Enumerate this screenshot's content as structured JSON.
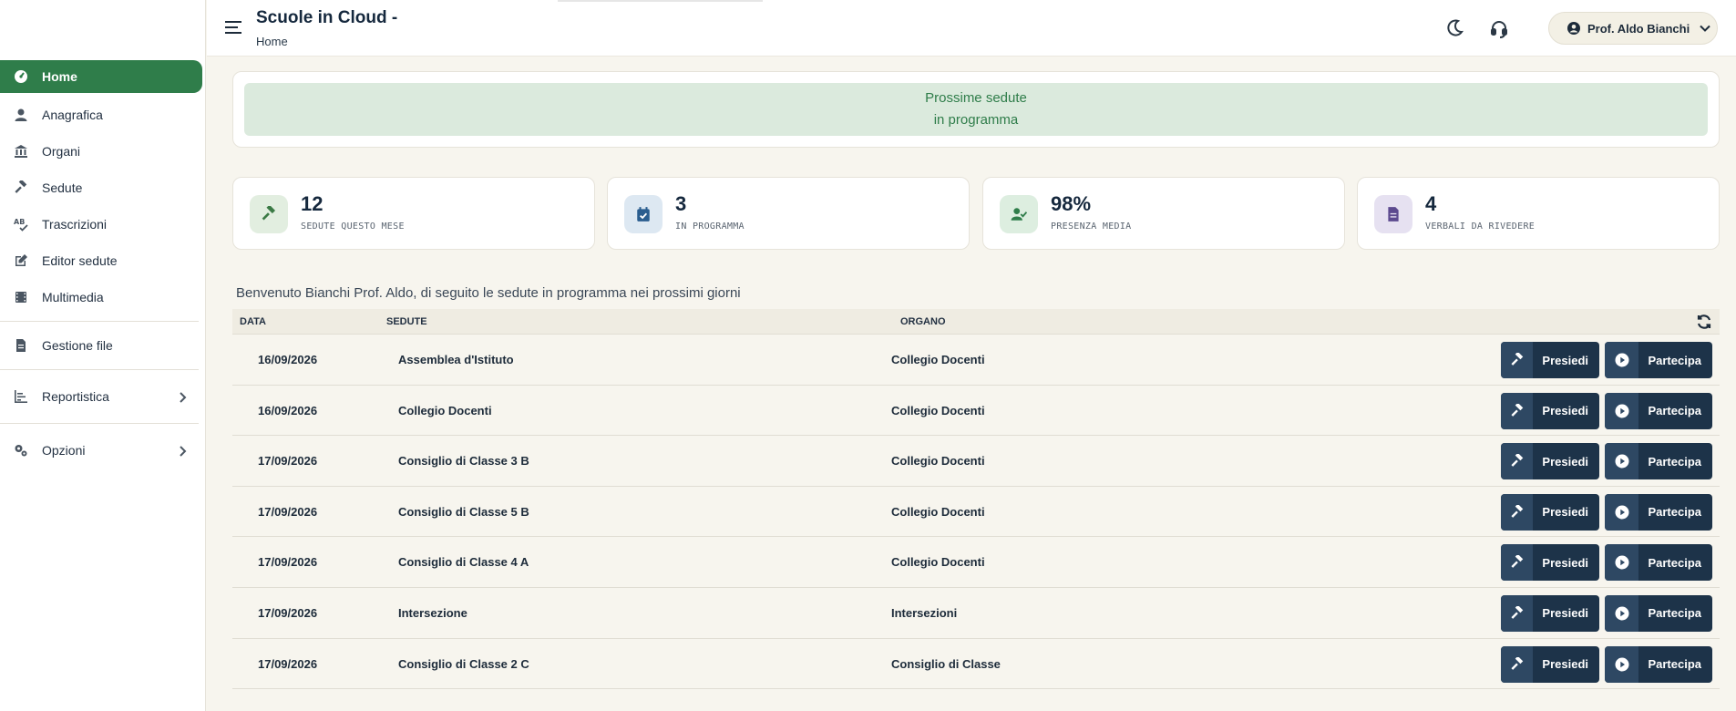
{
  "header": {
    "title": "Scuole in Cloud -",
    "breadcrumb": "Home",
    "user_name": "Prof. Aldo Bianchi"
  },
  "sidebar": {
    "items": [
      {
        "label": "Home",
        "icon": "dashboard-icon",
        "active": true
      },
      {
        "label": "Anagrafica",
        "icon": "user-icon"
      },
      {
        "label": "Organi",
        "icon": "building-icon"
      },
      {
        "label": "Sedute",
        "icon": "gavel-icon"
      },
      {
        "label": "Trascrizioni",
        "icon": "spellcheck-icon"
      },
      {
        "label": "Editor sedute",
        "icon": "edit-icon"
      },
      {
        "label": "Multimedia",
        "icon": "film-icon"
      },
      {
        "label": "Gestione file",
        "icon": "file-icon"
      },
      {
        "label": "Reportistica",
        "icon": "chart-icon"
      },
      {
        "label": "Opzioni",
        "icon": "gears-icon"
      }
    ]
  },
  "banner": {
    "line1": "Prossime sedute",
    "line2": "in programma"
  },
  "stats": [
    {
      "value": "12",
      "label": "SEDUTE QUESTO MESE",
      "color": "#e2eee0",
      "icon_color": "#3b7a45"
    },
    {
      "value": "3",
      "label": "IN PROGRAMMA",
      "color": "#dde8f2",
      "icon_color": "#2a5d8f"
    },
    {
      "value": "98%",
      "label": "PRESENZA MEDIA",
      "color": "#ddeee0",
      "icon_color": "#2f7d4a"
    },
    {
      "value": "4",
      "label": "VERBALI DA RIVEDERE",
      "color": "#e6e1f1",
      "icon_color": "#5c4a8f"
    }
  ],
  "welcome": "Benvenuto Bianchi Prof. Aldo, di seguito le sedute in programma nei prossimi giorni",
  "table": {
    "headers": {
      "data": "DATA",
      "sedute": "SEDUTE",
      "organo": "ORGANO"
    },
    "buttons": {
      "presiedi": "Presiedi",
      "partecipa": "Partecipa"
    },
    "rows": [
      {
        "data": "16/09/2026",
        "seduta": "Assemblea d'Istituto",
        "organo": "Collegio Docenti"
      },
      {
        "data": "16/09/2026",
        "seduta": "Collegio Docenti",
        "organo": "Collegio Docenti"
      },
      {
        "data": "17/09/2026",
        "seduta": "Consiglio di Classe 3 B",
        "organo": "Collegio Docenti"
      },
      {
        "data": "17/09/2026",
        "seduta": "Consiglio di Classe 5 B",
        "organo": "Collegio Docenti"
      },
      {
        "data": "17/09/2026",
        "seduta": "Consiglio di Classe 4 A",
        "organo": "Collegio Docenti"
      },
      {
        "data": "17/09/2026",
        "seduta": "Intersezione",
        "organo": "Intersezioni"
      },
      {
        "data": "17/09/2026",
        "seduta": "Consiglio di Classe 2 C",
        "organo": "Consiglio di Classe"
      }
    ]
  }
}
